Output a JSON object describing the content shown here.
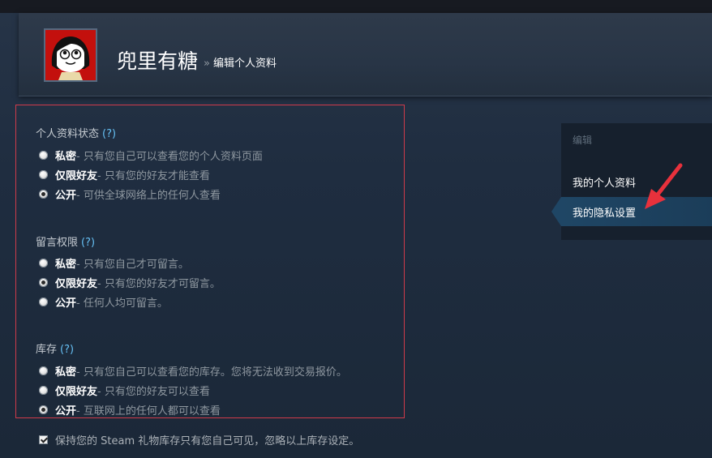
{
  "profile": {
    "username": "兜里有糖",
    "breadcrumb_sep": "»",
    "breadcrumb": "编辑个人资料"
  },
  "sections": [
    {
      "title": "个人资料状态",
      "help": "(?)",
      "options": [
        {
          "label": "私密",
          "desc": "只有您自己可以查看您的个人资料页面",
          "selected": false
        },
        {
          "label": "仅限好友",
          "desc": "只有您的好友才能查看",
          "selected": false
        },
        {
          "label": "公开",
          "desc": "可供全球网络上的任何人查看",
          "selected": true
        }
      ]
    },
    {
      "title": "留言权限",
      "help": "(?)",
      "options": [
        {
          "label": "私密",
          "desc": "只有您自己才可留言。",
          "selected": false
        },
        {
          "label": "仅限好友",
          "desc": "只有您的好友才可留言。",
          "selected": true
        },
        {
          "label": "公开",
          "desc": "任何人均可留言。",
          "selected": false
        }
      ]
    },
    {
      "title": "库存",
      "help": "(?)",
      "options": [
        {
          "label": "私密",
          "desc": "只有您自己可以查看您的库存。您将无法收到交易报价。",
          "selected": false
        },
        {
          "label": "仅限好友",
          "desc": "只有您的好友可以查看",
          "selected": false
        },
        {
          "label": "公开",
          "desc": "互联网上的任何人都可以查看",
          "selected": true
        }
      ]
    }
  ],
  "gift_checkbox": {
    "label": "保持您的 Steam 礼物库存只有您自己可见，忽略以上库存设定。",
    "checked": true
  },
  "sidebar": {
    "heading": "编辑",
    "items": [
      {
        "label": "我的个人资料",
        "active": false
      },
      {
        "label": "我的隐私设置",
        "active": true
      }
    ]
  },
  "colors": {
    "background": "#1b2838",
    "highlight_box": "#d03b4a",
    "help_link": "#66c0f4",
    "sidebar_active": "#1f4665",
    "annotation_arrow": "#e8313c"
  },
  "icons": [
    "avatar",
    "radio",
    "checkbox",
    "annotation-arrow-icon"
  ]
}
